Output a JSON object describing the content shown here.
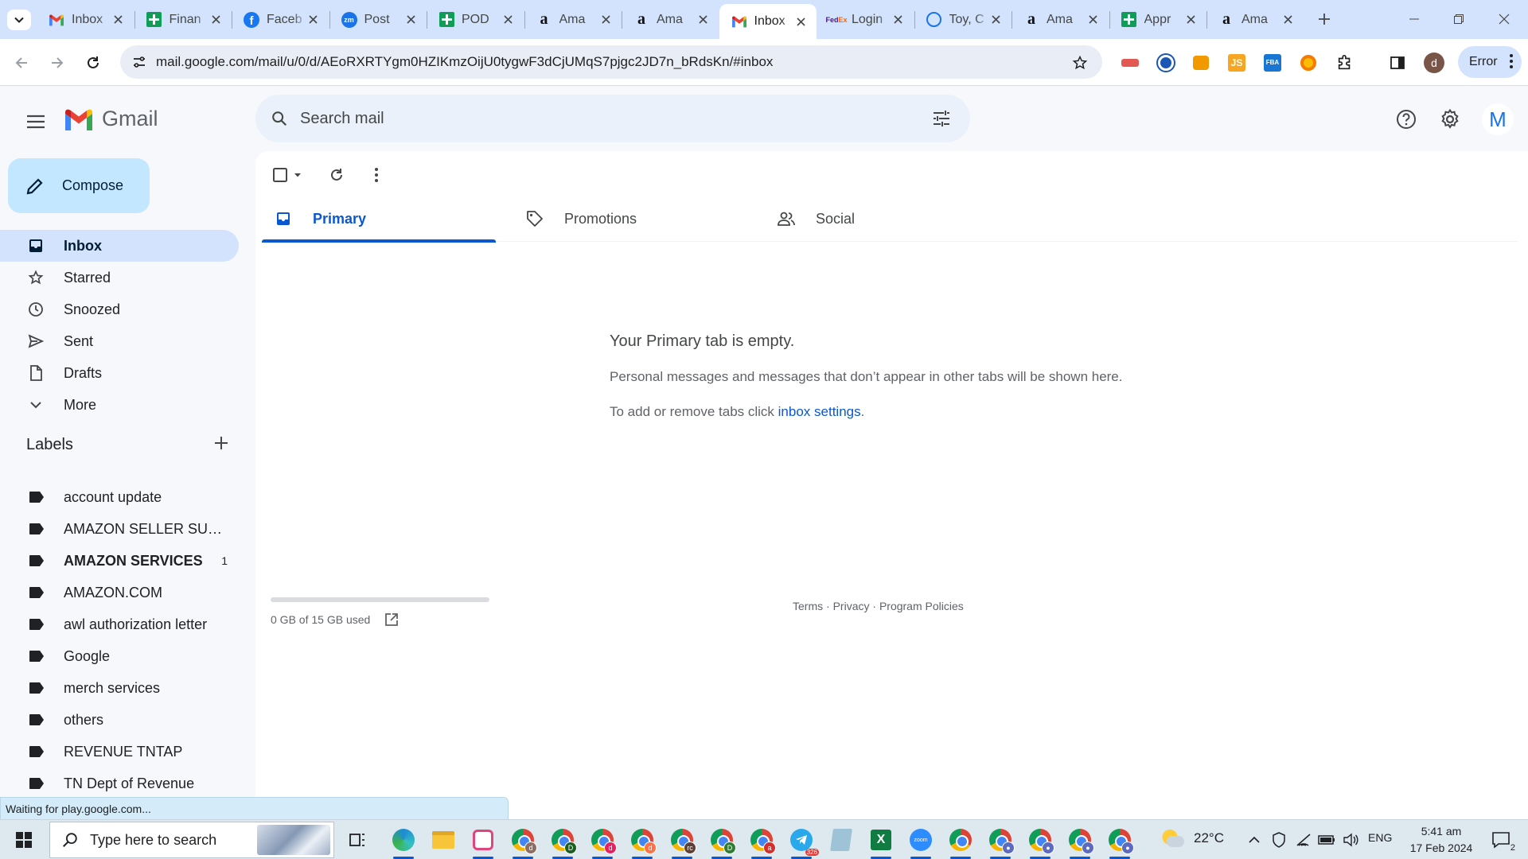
{
  "browser": {
    "tabs": [
      {
        "icon": "gmail-icon",
        "title": "Inbox"
      },
      {
        "icon": "sheets-icon",
        "title": "Finan"
      },
      {
        "icon": "facebook-icon",
        "title": "Faceb"
      },
      {
        "icon": "zoho-icon",
        "title": "Post"
      },
      {
        "icon": "sheets-icon",
        "title": "POD"
      },
      {
        "icon": "amazon-icon",
        "title": "Ama"
      },
      {
        "icon": "amazon-icon",
        "title": "Ama"
      },
      {
        "icon": "gmail-icon",
        "title": "Inbox",
        "active": true
      },
      {
        "icon": "fedex-icon",
        "title": "Login"
      },
      {
        "icon": "globe-icon",
        "title": "Toy, C"
      },
      {
        "icon": "amazon-icon",
        "title": "Ama"
      },
      {
        "icon": "sheets-icon",
        "title": "Appr"
      },
      {
        "icon": "amazon-icon",
        "title": "Ama"
      }
    ],
    "url": "mail.google.com/mail/u/0/d/AEoRXRTYgm0HZIKmzOijU0tygwF3dCjUMqS7pjgc2JD7n_bRdsKn/#inbox",
    "error_label": "Error",
    "profile_initial": "d",
    "status_text": "Waiting for play.google.com...",
    "zoho_badge": "zm",
    "fedex_fav": "Fed",
    "fedex_fav_ex": "Ex"
  },
  "gmail": {
    "logo_text": "Gmail",
    "search_placeholder": "Search mail",
    "account_initial": "M",
    "compose_label": "Compose",
    "nav": [
      {
        "icon": "inbox-icon",
        "label": "Inbox",
        "active": true
      },
      {
        "icon": "star-icon",
        "label": "Starred"
      },
      {
        "icon": "clock-icon",
        "label": "Snoozed"
      },
      {
        "icon": "send-icon",
        "label": "Sent"
      },
      {
        "icon": "draft-icon",
        "label": "Drafts"
      },
      {
        "icon": "chevron-down-icon",
        "label": "More"
      }
    ],
    "labels_heading": "Labels",
    "labels": [
      {
        "name": "account update"
      },
      {
        "name": "AMAZON SELLER SUPP..."
      },
      {
        "name": "AMAZON SERVICES",
        "count": "1",
        "bold": true
      },
      {
        "name": "AMAZON.COM"
      },
      {
        "name": "awl authorization letter"
      },
      {
        "name": "Google"
      },
      {
        "name": "merch services"
      },
      {
        "name": "others"
      },
      {
        "name": "REVENUE TNTAP"
      },
      {
        "name": "TN Dept of Revenue"
      }
    ],
    "category_tabs": [
      {
        "icon": "inbox-tab-icon",
        "label": "Primary",
        "active": true
      },
      {
        "icon": "tag-icon",
        "label": "Promotions"
      },
      {
        "icon": "people-icon",
        "label": "Social"
      }
    ],
    "empty": {
      "title": "Your Primary tab is empty.",
      "description": "Personal messages and messages that don’t appear in other tabs will be shown here.",
      "settings_prefix": "To add or remove tabs click ",
      "settings_link": "inbox settings",
      "settings_suffix": "."
    },
    "storage": {
      "text": "0 GB of 15 GB used",
      "used_fraction": 0
    },
    "footer": {
      "terms": "Terms",
      "privacy": "Privacy",
      "policies": "Program Policies",
      "sep": " · "
    }
  },
  "taskbar": {
    "search_placeholder": "Type here to search",
    "temperature": "22°C",
    "language": "ENG",
    "time": "5:41 am",
    "date": "17 Feb 2024",
    "notification_count": "2",
    "telegram_badge": "326",
    "zoom_label": "zoom",
    "excel_letter": "X",
    "chrome_profiles": [
      "d",
      "D",
      "d",
      "d",
      "rc",
      "D",
      "a"
    ]
  },
  "colors": {
    "accent": "#0b57d0",
    "compose_bg": "#c2e7ff",
    "active_nav": "#d3e3fd",
    "tabstrip": "#d3e3fd"
  }
}
